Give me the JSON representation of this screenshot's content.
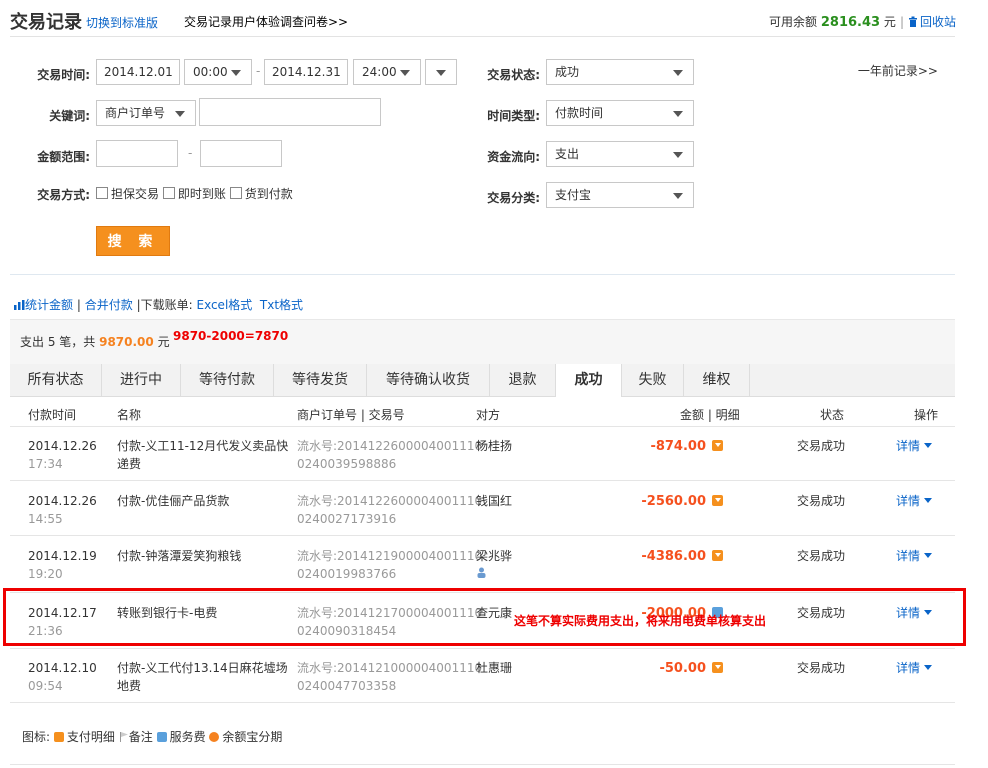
{
  "header": {
    "title": "交易记录",
    "switch_label": "切换到标准版",
    "survey_label": "交易记录用户体验调查问卷>>",
    "balance_label": "可用余额",
    "balance_value": "2816.43",
    "balance_unit": "元",
    "recycle_label": "回收站"
  },
  "filters": {
    "trade_time_label": "交易时间:",
    "start_date": "2014.12.01",
    "start_time": "00:00",
    "end_date": "2014.12.31",
    "end_time": "24:00",
    "status_label": "交易状态:",
    "status_value": "成功",
    "older_records": "一年前记录>>",
    "keyword_label": "关键词:",
    "keyword_type": "商户订单号",
    "keyword_value": "",
    "time_type_label": "时间类型:",
    "time_type_value": "付款时间",
    "amount_label": "金额范围:",
    "amount_min": "",
    "amount_max": "",
    "fund_flow_label": "资金流向:",
    "fund_flow_value": "支出",
    "method_label": "交易方式:",
    "method_options": [
      "担保交易",
      "即时到账",
      "货到付款"
    ],
    "category_label": "交易分类:",
    "category_value": "支付宝",
    "search_button": "搜 索"
  },
  "toolbar": {
    "stats": "统计金额",
    "merge": "合并付款",
    "download_label": "下载账单:",
    "excel": "Excel格式",
    "txt": "Txt格式"
  },
  "summary": {
    "prefix": "支出 5 笔，共",
    "amount": "9870.00",
    "unit": "元",
    "calc_note": "9870-2000=7870"
  },
  "tabs": [
    "所有状态",
    "进行中",
    "等待付款",
    "等待发货",
    "等待确认收货",
    "退款",
    "成功",
    "失败",
    "维权"
  ],
  "active_tab": "成功",
  "columns": {
    "time": "付款时间",
    "name": "名称",
    "order": "商户订单号 | 交易号",
    "party": "对方",
    "amount": "金额 | 明细",
    "status": "状态",
    "action": "操作"
  },
  "rows": [
    {
      "date": "2014.12.26",
      "time": "17:34",
      "name1": "付款-义工11-12月代发义卖品快",
      "name2": "递费",
      "serial1": "流水号:2014122600004001110",
      "serial2": "0240039598886",
      "party": "杨桂扬",
      "amount": "-874.00",
      "status": "交易成功",
      "action": "详情"
    },
    {
      "date": "2014.12.26",
      "time": "14:55",
      "name1": "付款-优佳俪产品货款",
      "name2": "",
      "serial1": "流水号:2014122600004001110",
      "serial2": "0240027173916",
      "party": "钱国红",
      "amount": "-2560.00",
      "status": "交易成功",
      "action": "详情"
    },
    {
      "date": "2014.12.19",
      "time": "19:20",
      "name1": "付款-钟落潭爱笑狗粮钱",
      "name2": "",
      "serial1": "流水号:2014121900004001110",
      "serial2": "0240019983766",
      "party": "梁兆骅",
      "amount": "-4386.00",
      "status": "交易成功",
      "action": "详情"
    },
    {
      "date": "2014.12.17",
      "time": "21:36",
      "name1": "转账到银行卡-电费",
      "name2": "",
      "serial1": "流水号:2014121700004001110",
      "serial2": "0240090318454",
      "party": "查元康",
      "amount": "-2000.00",
      "status": "交易成功",
      "action": "详情"
    },
    {
      "date": "2014.12.10",
      "time": "09:54",
      "name1": "付款-义工代付13.14日麻花墟场",
      "name2": "地费",
      "serial1": "流水号:2014121000004001110",
      "serial2": "0240047703358",
      "party": "杜惠珊",
      "amount": "-50.00",
      "status": "交易成功",
      "action": "详情"
    }
  ],
  "annotation": "这笔不算实际费用支出，将来用电费单核算支出",
  "legend": {
    "label": "图标:",
    "items": [
      "支付明细",
      "备注",
      "服务费",
      "余额宝分期"
    ]
  },
  "colors": {
    "accent_orange": "#f5901e",
    "link_blue": "#0a64c8",
    "amount_red": "#f5501e",
    "balance_green": "#2a8f1e",
    "annotation_red": "#e00000"
  }
}
